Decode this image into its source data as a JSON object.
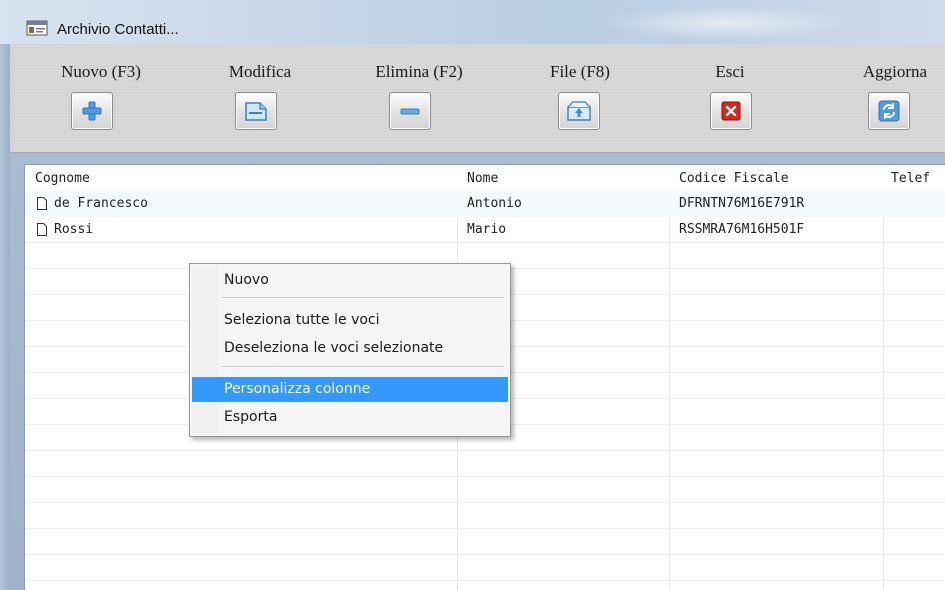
{
  "window": {
    "title": "Archivio Contatti..."
  },
  "toolbar": {
    "buttons": [
      {
        "label": "Nuovo (F3)",
        "icon": "plus-icon"
      },
      {
        "label": "Modifica",
        "icon": "edit-document-icon"
      },
      {
        "label": "Elimina (F2)",
        "icon": "minus-icon"
      },
      {
        "label": "File (F8)",
        "icon": "file-export-icon"
      },
      {
        "label": "Esci",
        "icon": "close-icon"
      },
      {
        "label": "Aggiorna",
        "icon": "refresh-icon"
      }
    ]
  },
  "table": {
    "columns": [
      "Cognome",
      "Nome",
      "Codice Fiscale",
      "Telef"
    ],
    "rows": [
      {
        "cognome": "de Francesco",
        "nome": "Antonio",
        "codice_fiscale": "DFRNTN76M16E791R"
      },
      {
        "cognome": "Rossi",
        "nome": "Mario",
        "codice_fiscale": "RSSMRA76M16H501F"
      }
    ]
  },
  "context_menu": {
    "items": [
      {
        "label": "Nuovo"
      },
      {
        "label": "Seleziona tutte le voci"
      },
      {
        "label": "Deseleziona le voci selezionate"
      },
      {
        "label": "Personalizza colonne",
        "highlighted": true
      },
      {
        "label": "Esporta"
      }
    ]
  },
  "colors": {
    "highlight": "#3399ff",
    "delete_icon": "#d9261c",
    "accent_icon": "#3d8fd6"
  }
}
